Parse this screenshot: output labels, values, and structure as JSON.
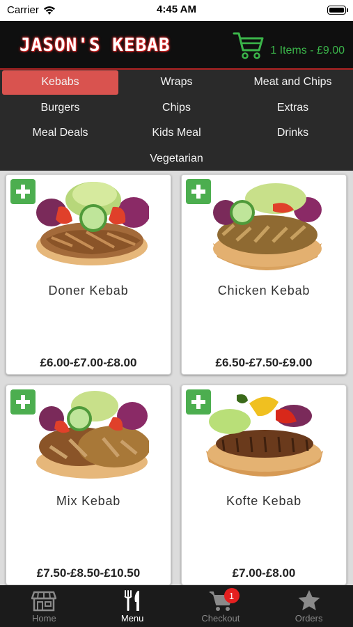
{
  "status_bar": {
    "carrier": "Carrier",
    "time": "4:45 AM"
  },
  "header": {
    "brand": "JASON'S KEBAB",
    "cart_summary": "1 Items - £9.00",
    "accent_color": "#3bb54a"
  },
  "categories": [
    {
      "label": "Kebabs",
      "active": true
    },
    {
      "label": "Wraps"
    },
    {
      "label": "Meat and Chips"
    },
    {
      "label": "Burgers"
    },
    {
      "label": "Chips"
    },
    {
      "label": "Extras"
    },
    {
      "label": "Meal Deals"
    },
    {
      "label": "Kids Meal"
    },
    {
      "label": "Drinks"
    },
    {
      "label": "Vegetarian"
    }
  ],
  "products": [
    {
      "name": "Doner Kebab",
      "price": "£6.00-£7.00-£8.00"
    },
    {
      "name": "Chicken Kebab",
      "price": "£6.50-£7.50-£9.00"
    },
    {
      "name": "Mix Kebab",
      "price": "£7.50-£8.50-£10.50"
    },
    {
      "name": "Kofte Kebab",
      "price": "£7.00-£8.00"
    }
  ],
  "tabs": [
    {
      "label": "Home",
      "icon": "store-icon"
    },
    {
      "label": "Menu",
      "icon": "fork-knife-icon",
      "active": true
    },
    {
      "label": "Checkout",
      "icon": "cart-icon",
      "badge": "1"
    },
    {
      "label": "Orders",
      "icon": "star-icon"
    }
  ]
}
